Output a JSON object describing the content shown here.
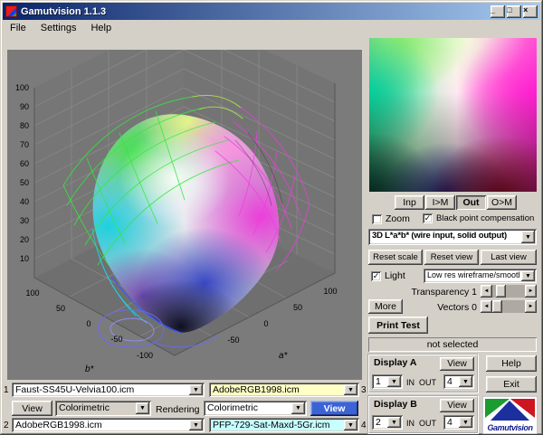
{
  "titlebar": {
    "title": "Gamutvision 1.1.3"
  },
  "menu": {
    "items": [
      "File",
      "Settings",
      "Help"
    ]
  },
  "icons": {
    "minimize": "_",
    "maximize": "□",
    "close": "×",
    "check": "✓",
    "dropdown": "▼",
    "left_arrow": "◄",
    "right_arrow": "►"
  },
  "colors": {
    "titlebar_left": "#0a246a",
    "titlebar_right": "#a6caf0",
    "plot_background": "#7b7b7b",
    "output_profile_field": "#ffffc6",
    "second_output_profile_field": "#c6ffff",
    "active_view_button": "#3b63d6"
  },
  "plot": {
    "l_ticks": [
      "100",
      "90",
      "80",
      "70",
      "60",
      "50",
      "40",
      "30",
      "20",
      "10"
    ],
    "b_ticks": [
      "100",
      "50",
      "0",
      "-50",
      "-100"
    ],
    "a_ticks": [
      "-50",
      "0",
      "50",
      "100"
    ],
    "b_axis_label": "b*",
    "a_axis_label": "a*"
  },
  "right_panel": {
    "map_buttons": [
      {
        "label": "Inp"
      },
      {
        "label": "I>M"
      },
      {
        "label": "Out"
      },
      {
        "label": "O>M"
      }
    ],
    "zoom_label": "Zoom",
    "bpc_label": "Black point compensation",
    "mode_value": "3D L*a*b* (wire input, solid output)",
    "reset_scale_label": "Reset scale",
    "reset_view_label": "Reset view",
    "last_view_label": "Last view",
    "light_label": "Light",
    "wireframe_value": "Low res wireframe/smooth",
    "transparency_label": "Transparency 1",
    "more_label": "More",
    "vectors_label": "Vectors 0",
    "print_test_label": "Print Test",
    "status_text": "not selected",
    "help_label": "Help",
    "exit_label": "Exit"
  },
  "display_a": {
    "title": "Display A",
    "view_label": "View",
    "left_value": "1",
    "in_out_label": "IN  OUT",
    "right_value": "4"
  },
  "display_b": {
    "title": "Display B",
    "view_label": "View",
    "left_value": "2",
    "in_out_label": "IN  OUT",
    "right_value": "4"
  },
  "logo": {
    "text": "Gamutvision"
  },
  "profiles": {
    "row1": {
      "index": "1",
      "input_profile": "Faust-SS45U-Velvia100.icm",
      "output_profile": "AdobeRGB1998.icm",
      "index_right": "3"
    },
    "row2": {
      "view_left_label": "View",
      "intent_left": "Colorimetric",
      "rendering_label": "Rendering",
      "intent_right": "Colorimetric",
      "view_right_label": "View"
    },
    "row3": {
      "index": "2",
      "input_profile": "AdobeRGB1998.icm",
      "output_profile": "PFP-729-Sat-Maxd-5Gr.icm",
      "index_right": "4"
    }
  }
}
